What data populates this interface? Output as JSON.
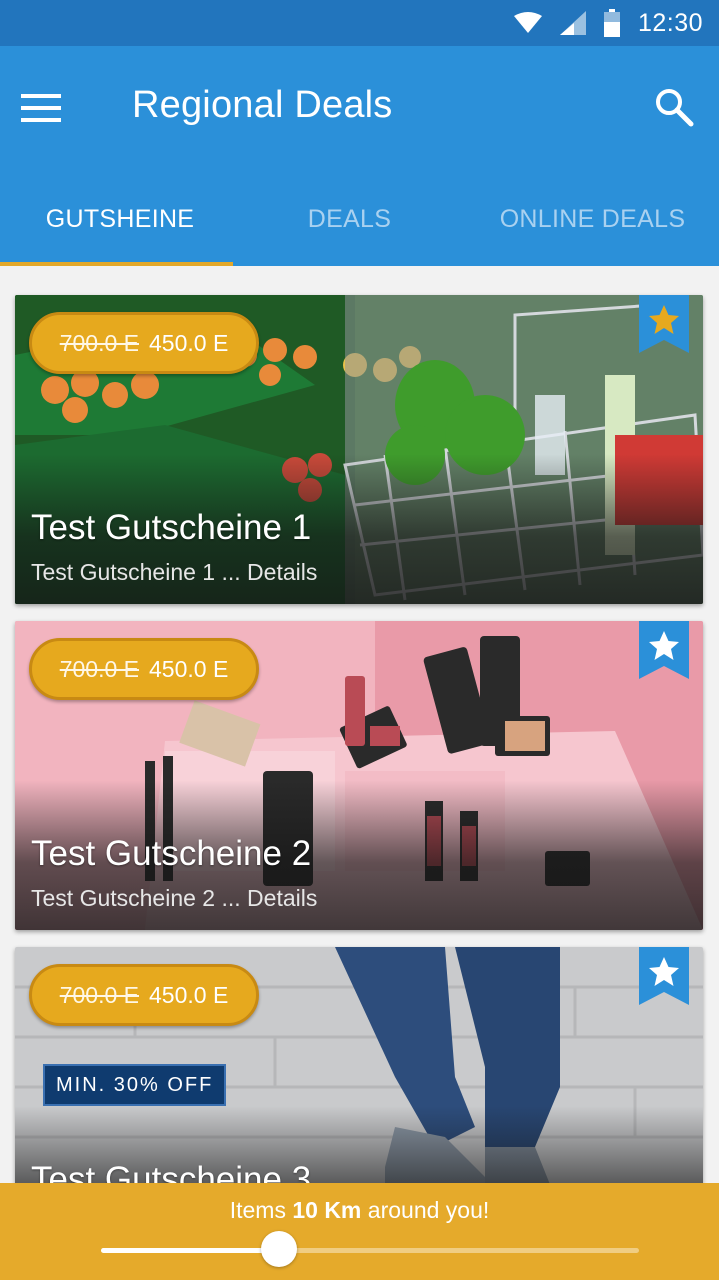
{
  "status_bar": {
    "time": "12:30",
    "icons": [
      "wifi-icon",
      "signal-icon",
      "battery-icon"
    ]
  },
  "app_bar": {
    "title": "Regional Deals",
    "menu_icon": "menu-icon",
    "search_icon": "search-icon"
  },
  "tabs": [
    {
      "label": "GUTSHEINE",
      "active": true
    },
    {
      "label": "DEALS",
      "active": false
    },
    {
      "label": "ONLINE DEALS",
      "active": false
    }
  ],
  "cards": [
    {
      "old_price": "700.0 E",
      "new_price": "450.0 E",
      "title": "Test Gutscheine 1",
      "subtitle": "Test Gutscheine 1 ... Details",
      "favorite": true,
      "image": "supermarket-cart"
    },
    {
      "old_price": "700.0 E",
      "new_price": "450.0 E",
      "title": "Test Gutscheine 2",
      "subtitle": "Test Gutscheine 2 ... Details",
      "favorite": false,
      "image": "cosmetics"
    },
    {
      "old_price": "700.0 E",
      "new_price": "450.0 E",
      "title": "Test Gutscheine 3",
      "badge": "MIN. 30% OFF",
      "favorite": false,
      "image": "jeans-sneakers"
    }
  ],
  "radius_bar": {
    "text_before": "Items ",
    "distance": "10 Km",
    "text_after": " around you!",
    "slider_fraction": 0.33
  },
  "colors": {
    "primary": "#2b90d9",
    "status_bar": "#2275bd",
    "accent": "#e5aa2b",
    "badge_bg": "#0f3b6f"
  }
}
